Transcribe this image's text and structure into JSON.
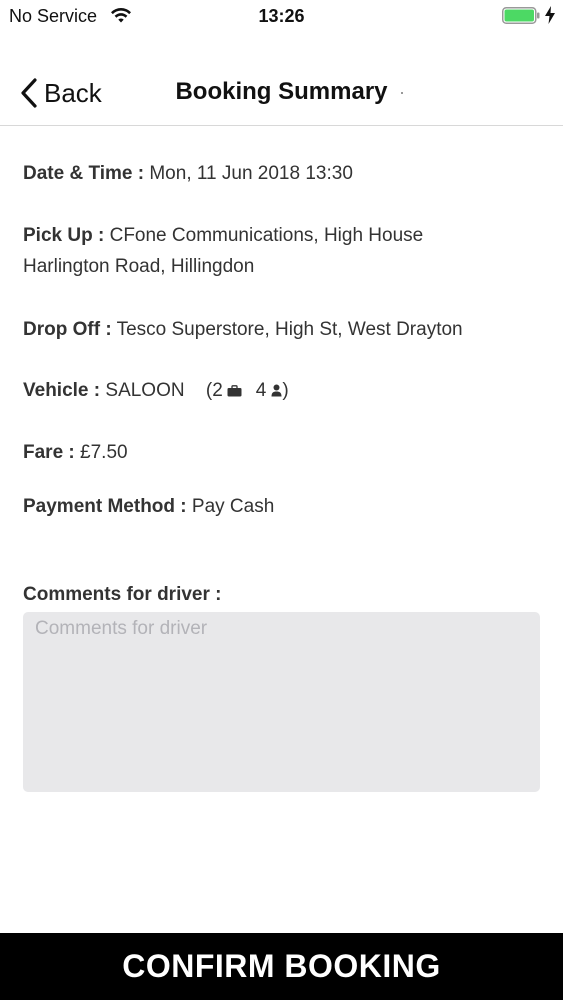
{
  "status_bar": {
    "carrier": "No Service",
    "time": "13:26",
    "wifi_icon": "wifi-icon",
    "battery_icon": "battery-full-icon",
    "charging_icon": "bolt-icon",
    "battery_color": "#4cd964"
  },
  "nav": {
    "back_label": "Back",
    "back_icon": "chevron-left-icon",
    "title": "Booking Summary"
  },
  "summary": {
    "datetime": {
      "label": "Date & Time :",
      "value": "Mon, 11 Jun 2018 13:30"
    },
    "pickup": {
      "label": "Pick Up :",
      "value": "CFone Communications, High House",
      "value_line2": "Harlington Road, Hillingdon"
    },
    "dropoff": {
      "label": "Drop Off :",
      "value": "Tesco Superstore, High St, West Drayton"
    },
    "vehicle": {
      "label": "Vehicle :",
      "value": "SALOON",
      "open_paren": "(",
      "luggage_count": "2",
      "luggage_icon": "briefcase-icon",
      "passenger_count": "4",
      "passenger_icon": "person-icon",
      "close_paren": ")"
    },
    "fare": {
      "label": "Fare :",
      "value": "£7.50"
    },
    "payment": {
      "label": "Payment Method :",
      "value": "Pay Cash"
    }
  },
  "comments": {
    "label": "Comments for driver :",
    "placeholder": "Comments for driver",
    "value": ""
  },
  "confirm_button": {
    "label": "CONFIRM BOOKING",
    "background": "#000000",
    "color": "#ffffff"
  }
}
